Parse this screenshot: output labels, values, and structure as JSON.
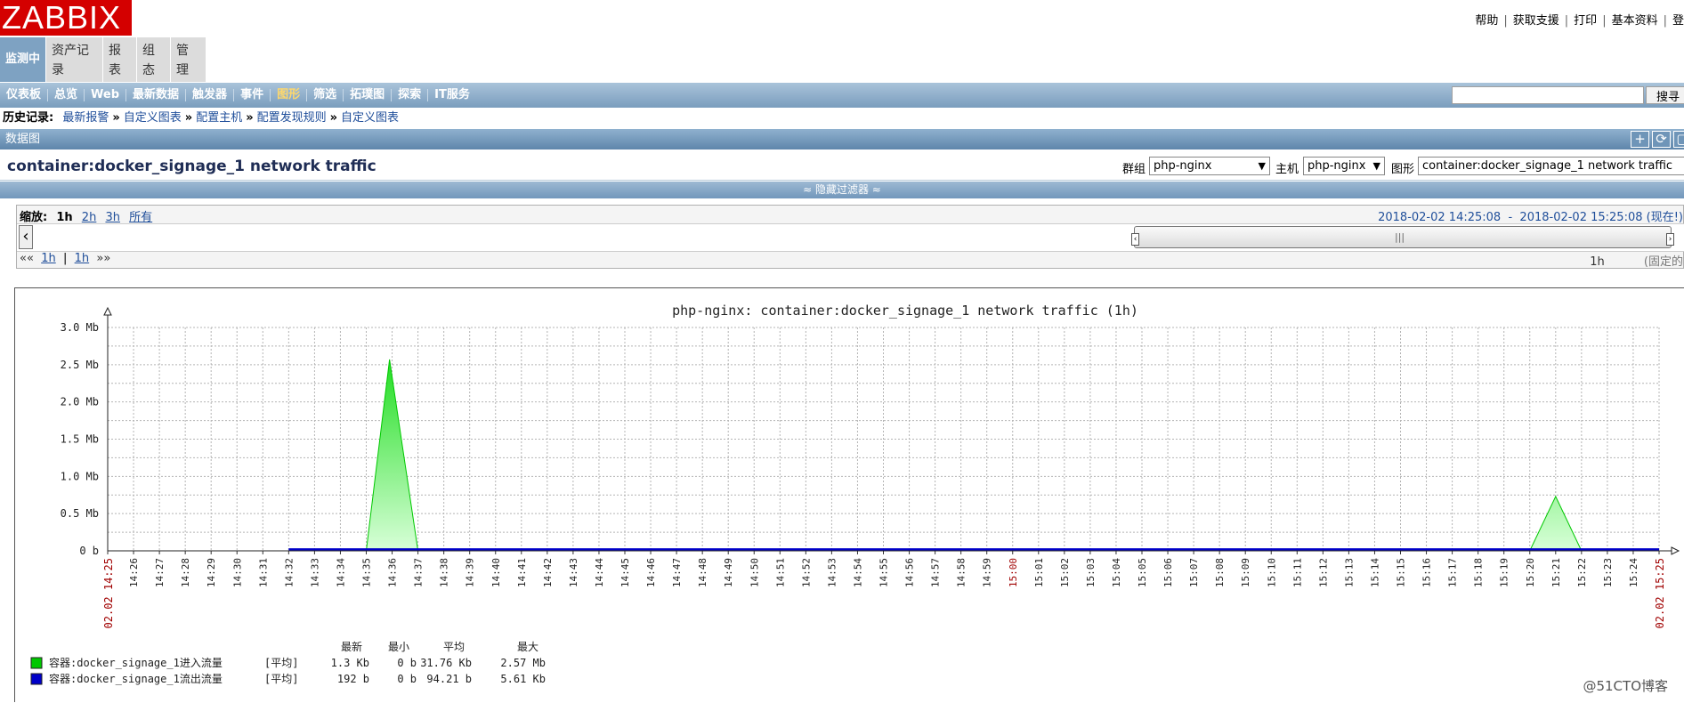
{
  "header": {
    "logo": "ZABBIX",
    "links": [
      "帮助",
      "获取支援",
      "打印",
      "基本资料",
      "登"
    ]
  },
  "main_tabs": [
    {
      "label": "监测中",
      "active": true
    },
    {
      "label": "资产记录",
      "active": false
    },
    {
      "label": "报表",
      "active": false
    },
    {
      "label": "组态",
      "active": false
    },
    {
      "label": "管理",
      "active": false
    }
  ],
  "sub_nav": [
    {
      "label": "仪表板",
      "active": false
    },
    {
      "label": "总览",
      "active": false
    },
    {
      "label": "Web",
      "active": false
    },
    {
      "label": "最新数据",
      "active": false
    },
    {
      "label": "触发器",
      "active": false
    },
    {
      "label": "事件",
      "active": false
    },
    {
      "label": "图形",
      "active": true
    },
    {
      "label": "筛选",
      "active": false
    },
    {
      "label": "拓璞图",
      "active": false
    },
    {
      "label": "探索",
      "active": false
    },
    {
      "label": "IT服务",
      "active": false
    }
  ],
  "search": {
    "value": "",
    "button": "搜寻"
  },
  "history": {
    "label": "历史记录:",
    "items": [
      "最新报警",
      "自定义图表",
      "配置主机",
      "配置发现规则",
      "自定义图表"
    ]
  },
  "section": {
    "title": "数据图"
  },
  "title_row": {
    "graph_title": "container:docker_signage_1 network traffic",
    "group_label": "群组",
    "group_value": "php-nginx",
    "host_label": "主机",
    "host_value": "php-nginx",
    "graph_label": "图形",
    "graph_value": "container:docker_signage_1 network traffic"
  },
  "filter_toggle": "≈ 隐藏过滤器 ≈",
  "zoom": {
    "label": "缩放:",
    "current": "1h",
    "options": [
      "2h",
      "3h",
      "所有"
    ],
    "period_start": "2018-02-02 14:25:08",
    "period_sep": "-",
    "period_end": "2018-02-02 15:25:08",
    "period_suffix": "(现在!)",
    "nav_back": "««",
    "nav_1h_a": "1h",
    "nav_sep": "|",
    "nav_1h_b": "1h",
    "nav_fwd": "»»",
    "period_length": "1h",
    "fixed": "(固定的"
  },
  "chart_data": {
    "type": "area",
    "title": "php-nginx: container:docker_signage_1 network traffic (1h)",
    "y_ticks": [
      "0 b",
      "0.5 Mb",
      "1.0 Mb",
      "1.5 Mb",
      "2.0 Mb",
      "2.5 Mb",
      "3.0 Mb"
    ],
    "ylim": [
      0,
      3.0
    ],
    "x_start_label": "02.02 14:25",
    "x_end_label": "02.02 15:25",
    "x_ticks": [
      "14:26",
      "14:27",
      "14:28",
      "14:29",
      "14:30",
      "14:31",
      "14:32",
      "14:33",
      "14:34",
      "14:35",
      "14:36",
      "14:37",
      "14:38",
      "14:39",
      "14:40",
      "14:41",
      "14:42",
      "14:43",
      "14:44",
      "14:45",
      "14:46",
      "14:47",
      "14:48",
      "14:49",
      "14:50",
      "14:51",
      "14:52",
      "14:53",
      "14:54",
      "14:55",
      "14:56",
      "14:57",
      "14:58",
      "14:59",
      "15:00",
      "15:01",
      "15:02",
      "15:03",
      "15:04",
      "15:05",
      "15:06",
      "15:07",
      "15:08",
      "15:09",
      "15:10",
      "15:11",
      "15:12",
      "15:13",
      "15:14",
      "15:15",
      "15:16",
      "15:17",
      "15:18",
      "15:19",
      "15:20",
      "15:21",
      "15:22",
      "15:23",
      "15:24"
    ],
    "highlight_tick": "15:00",
    "series": [
      {
        "name": "容器:docker_signage_1进入流量",
        "color": "#00c800",
        "points": [
          [
            7,
            0
          ],
          [
            10,
            0
          ],
          [
            10.9,
            2.57
          ],
          [
            12,
            0
          ],
          [
            55,
            0
          ],
          [
            56,
            0.73
          ],
          [
            57,
            0
          ],
          [
            60,
            0
          ]
        ]
      },
      {
        "name": "容器:docker_signage_1流出流量",
        "color": "#0000c8",
        "points": [
          [
            7,
            0.004
          ],
          [
            60,
            0.004
          ]
        ]
      }
    ],
    "legend": {
      "headers": [
        "最新",
        "最小",
        "平均",
        "最大"
      ],
      "rows": [
        {
          "name": "容器:docker_signage_1进入流量",
          "func": "[平均]",
          "last": "1.3 Kb",
          "min": "0 b",
          "avg": "31.76 Kb",
          "max": "2.57 Mb",
          "color": "#00c800"
        },
        {
          "name": "容器:docker_signage_1流出流量",
          "func": "[平均]",
          "last": "192 b",
          "min": "0 b",
          "avg": "94.21 b",
          "max": "5.61 Kb",
          "color": "#0000c8"
        }
      ]
    }
  },
  "watermark": "@51CTO博客"
}
